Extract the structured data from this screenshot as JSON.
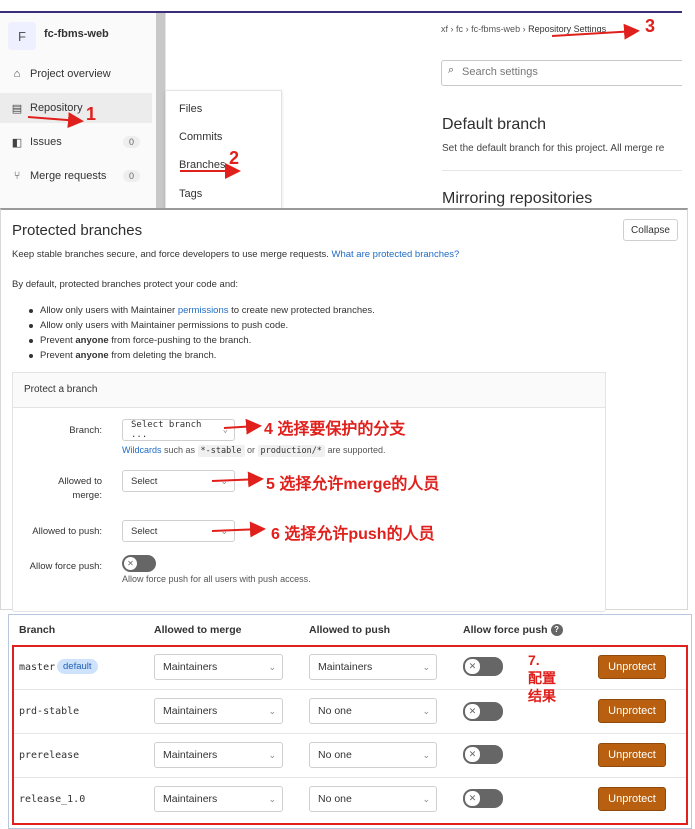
{
  "nav": {
    "project_initial": "F",
    "project_name": "fc-fbms-web",
    "items": [
      {
        "label": "Project overview",
        "icon": "home-icon"
      },
      {
        "label": "Repository",
        "icon": "document-icon"
      },
      {
        "label": "Issues",
        "icon": "issues-icon",
        "count": "0"
      },
      {
        "label": "Merge requests",
        "icon": "merge-request-icon",
        "count": "0"
      }
    ]
  },
  "flyout": [
    "Files",
    "Commits",
    "Branches",
    "Tags"
  ],
  "breadcrumb": [
    "xf",
    "fc",
    "fc-fbms-web",
    "Repository Settings"
  ],
  "search": {
    "placeholder": "Search settings"
  },
  "sections": {
    "default_branch_title": "Default branch",
    "default_branch_desc": "Set the default branch for this project. All merge re",
    "mirroring_title": "Mirroring repositories"
  },
  "protected": {
    "title": "Protected branches",
    "collapse": "Collapse",
    "intro_text": "Keep stable branches secure, and force developers to use merge requests. ",
    "intro_link": "What are protected branches?",
    "default_text": "By default, protected branches protect your code and:",
    "bullets": {
      "b1_pre": "Allow only users with Maintainer ",
      "b1_link": "permissions",
      "b1_post": " to create new protected branches.",
      "b2": "Allow only users with Maintainer permissions to push code.",
      "b3_pre": "Prevent ",
      "b3_bold": "anyone",
      "b3_post": " from force-pushing to the branch.",
      "b4_pre": "Prevent ",
      "b4_bold": "anyone",
      "b4_post": " from deleting the branch."
    },
    "form": {
      "header": "Protect a branch",
      "branch_label": "Branch:",
      "branch_value": "Select branch ...",
      "wildcards_link": "Wildcards",
      "wildcards_such": " such as ",
      "wildcard1": "*-stable",
      "wildcard_or": " or ",
      "wildcard2": "production/*",
      "wildcard_supported": " are supported.",
      "merge_label_1": "Allowed to",
      "merge_label_2": "merge:",
      "merge_value": "Select",
      "push_label": "Allowed to push:",
      "push_value": "Select",
      "force_label": "Allow force push:",
      "force_help": "Allow force push for all users with push access."
    }
  },
  "table": {
    "headers": [
      "Branch",
      "Allowed to merge",
      "Allowed to push",
      "Allow force push"
    ],
    "rows": [
      {
        "branch": "master",
        "badge": "default",
        "merge": "Maintainers",
        "push": "Maintainers",
        "action": "Unprotect"
      },
      {
        "branch": "prd-stable",
        "merge": "Maintainers",
        "push": "No one",
        "action": "Unprotect"
      },
      {
        "branch": "prerelease",
        "merge": "Maintainers",
        "push": "No one",
        "action": "Unprotect"
      },
      {
        "branch": "release_1.0",
        "merge": "Maintainers",
        "push": "No one",
        "action": "Unprotect"
      }
    ]
  },
  "annotations": {
    "n1": "1",
    "n2": "2",
    "n3": "3",
    "a4": "4 选择要保护的分支",
    "a5": "5 选择允许merge的人员",
    "a6": "6 选择允许push的人员",
    "a7_1": "7.",
    "a7_2": "配置",
    "a7_3": "结果"
  },
  "colors": {
    "annotation_red": "#e0201c",
    "unprotect_button": "#b8600f",
    "link_blue": "#1f6bc4"
  }
}
